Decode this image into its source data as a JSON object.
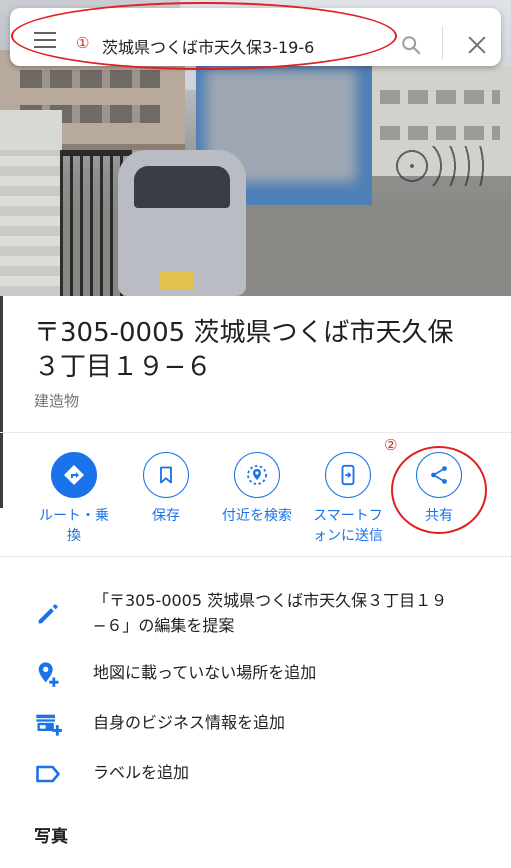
{
  "search": {
    "marker": "①",
    "query": "茨城県つくば市天久保3-19-6"
  },
  "place": {
    "title_line1": "〒305-0005 茨城県つくば市天久保",
    "title_line2": "３丁目１９−６",
    "category": "建造物"
  },
  "actions": {
    "marker": "②",
    "items": [
      {
        "label": "ルート・乗\n換",
        "icon": "directions-icon"
      },
      {
        "label": "保存",
        "icon": "bookmark-icon"
      },
      {
        "label": "付近を検索",
        "icon": "nearby-search-icon"
      },
      {
        "label": "スマートフ\nォンに送信",
        "icon": "send-to-phone-icon"
      },
      {
        "label": "共有",
        "icon": "share-icon"
      }
    ]
  },
  "list": {
    "suggest_edit_line1": "「〒305-0005 茨城県つくば市天久保３丁目１９",
    "suggest_edit_line2": "−６」の編集を提案",
    "add_missing_place": "地図に載っていない場所を追加",
    "add_business": "自身のビジネス情報を追加",
    "add_label": "ラベルを追加"
  },
  "photos": {
    "heading": "写真"
  },
  "colors": {
    "accent": "#1a73e8",
    "annotation": "#e02020"
  }
}
